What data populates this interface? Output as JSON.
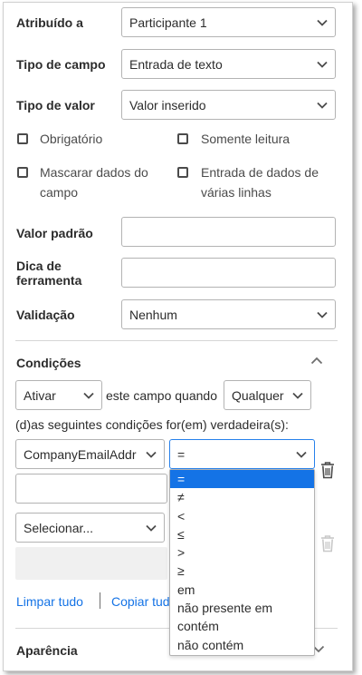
{
  "form": {
    "assigned_to": {
      "label": "Atribuído a",
      "value": "Participante 1"
    },
    "field_type": {
      "label": "Tipo de campo",
      "value": "Entrada de texto"
    },
    "value_type": {
      "label": "Tipo de valor",
      "value": "Valor inserido"
    },
    "checkboxes": {
      "required": "Obrigatório",
      "read_only": "Somente leitura",
      "mask_line1": "Mascarar dados do",
      "mask_line2": "campo",
      "multiline_line1": "Entrada de dados de",
      "multiline_line2": "várias linhas"
    },
    "default_value": {
      "label": "Valor padrão",
      "value": ""
    },
    "tooltip": {
      "label_line1": "Dica de",
      "label_line2": "ferramenta",
      "value": ""
    },
    "validation": {
      "label": "Validação",
      "value": "Nenhum"
    }
  },
  "conditions": {
    "title": "Condições",
    "action_value": "Ativar",
    "middle_text": "este campo quando",
    "match_value": "Qualquer",
    "sentence": "(d)as seguintes condições for(em) verdadeira(s):",
    "row1": {
      "field_value": "CompanyEmailAddr",
      "operator_value": "=",
      "input_value": ""
    },
    "row2": {
      "field_value": "Selecionar..."
    },
    "operator_options": [
      "=",
      "≠",
      "<",
      "≤",
      ">",
      "≥",
      "em",
      "não presente em",
      "contém",
      "não contém"
    ],
    "selected_operator_index": 0,
    "clear_all": "Limpar tudo",
    "copy_all": "Copiar tudo"
  },
  "appearance": {
    "title": "Aparência"
  },
  "icons": {
    "chevron": "chevron-down-icon",
    "collapse": "chevron-up-icon",
    "delete": "trash-icon"
  },
  "colors": {
    "accent": "#1473e6",
    "focus_border": "#2680eb",
    "text": "#2c2c2c"
  }
}
